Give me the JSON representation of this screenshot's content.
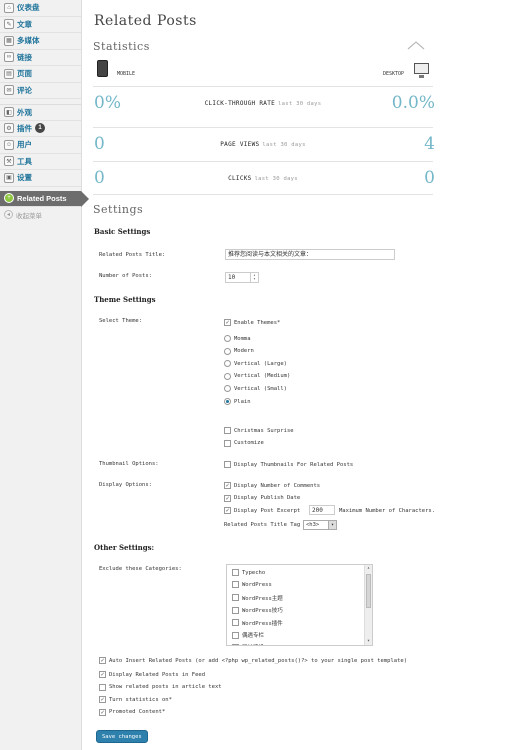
{
  "sidebar": {
    "items": [
      {
        "icon": "⌂",
        "label": "仪表盘"
      },
      {
        "icon": "✎",
        "label": "文章"
      },
      {
        "icon": "▦",
        "label": "多媒体"
      },
      {
        "icon": "∞",
        "label": "链接"
      },
      {
        "icon": "▤",
        "label": "页面"
      },
      {
        "icon": "✉",
        "label": "评论"
      },
      {
        "icon": "◧",
        "label": "外观"
      },
      {
        "icon": "⚙",
        "label": "插件",
        "badge": "1"
      },
      {
        "icon": "☺",
        "label": "用户"
      },
      {
        "icon": "⚒",
        "label": "工具"
      },
      {
        "icon": "▣",
        "label": "设置"
      }
    ],
    "active": {
      "icon": "+",
      "label": "Related Posts"
    },
    "collapse": {
      "icon": "◂",
      "label": "收起菜单"
    }
  },
  "page": {
    "title": "Related Posts"
  },
  "stats": {
    "heading": "Statistics",
    "mobile": "MOBILE",
    "desktop": "DESKTOP",
    "rows": [
      {
        "left": "0%",
        "label": "CLICK-THROUGH RATE",
        "period": "last 30 days",
        "right": "0.0%"
      },
      {
        "left": "0",
        "label": "PAGE VIEWS",
        "period": "last 30 days",
        "right": "4"
      },
      {
        "left": "0",
        "label": "CLICKS",
        "period": "last 30 days",
        "right": "0"
      }
    ]
  },
  "settings": {
    "heading": "Settings",
    "basic": {
      "heading": "Basic Settings",
      "title_label": "Related Posts Title:",
      "title_value": "推荐您阅读与本文相关的文章：",
      "num_label": "Number of Posts:",
      "num_value": "10"
    },
    "theme": {
      "heading": "Theme Settings",
      "select_label": "Select Theme:",
      "enable": "Enable Themes*",
      "options": [
        "Momma",
        "Modern",
        "Vertical (Large)",
        "Vertical (Medium)",
        "Vertical (Small)",
        "Plain"
      ],
      "extra": [
        "Christmas Surprise",
        "Customize"
      ],
      "thumb_label": "Thumbnail Options:",
      "thumb_opt": "Display Thumbnails For Related Posts",
      "disp_label": "Display Options:",
      "disp_opts": [
        "Display Number of Comments",
        "Display Publish Date",
        "Display Post Excerpt"
      ],
      "excerpt_value": "200",
      "excerpt_suffix": "Maximum Number of Characters.",
      "tag_label": "Related Posts Title Tag",
      "tag_value": "<h3>"
    },
    "other": {
      "heading": "Other Settings:",
      "exclude_label": "Exclude these Categories:",
      "categories": [
        "Typecho",
        "WordPress",
        "WordPress主题",
        "WordPress技巧",
        "WordPress插件",
        "偶遇专栏",
        "网站建设"
      ],
      "auto_insert": "Auto Insert Related Posts",
      "auto_insert_hint": "(or add <?php wp_related_posts()?> to your single post template)",
      "opts": [
        "Display Related Posts in Feed",
        "Show related posts in article text",
        "Turn statistics on*",
        "Promoted Content*"
      ]
    },
    "save": "Save changes"
  }
}
